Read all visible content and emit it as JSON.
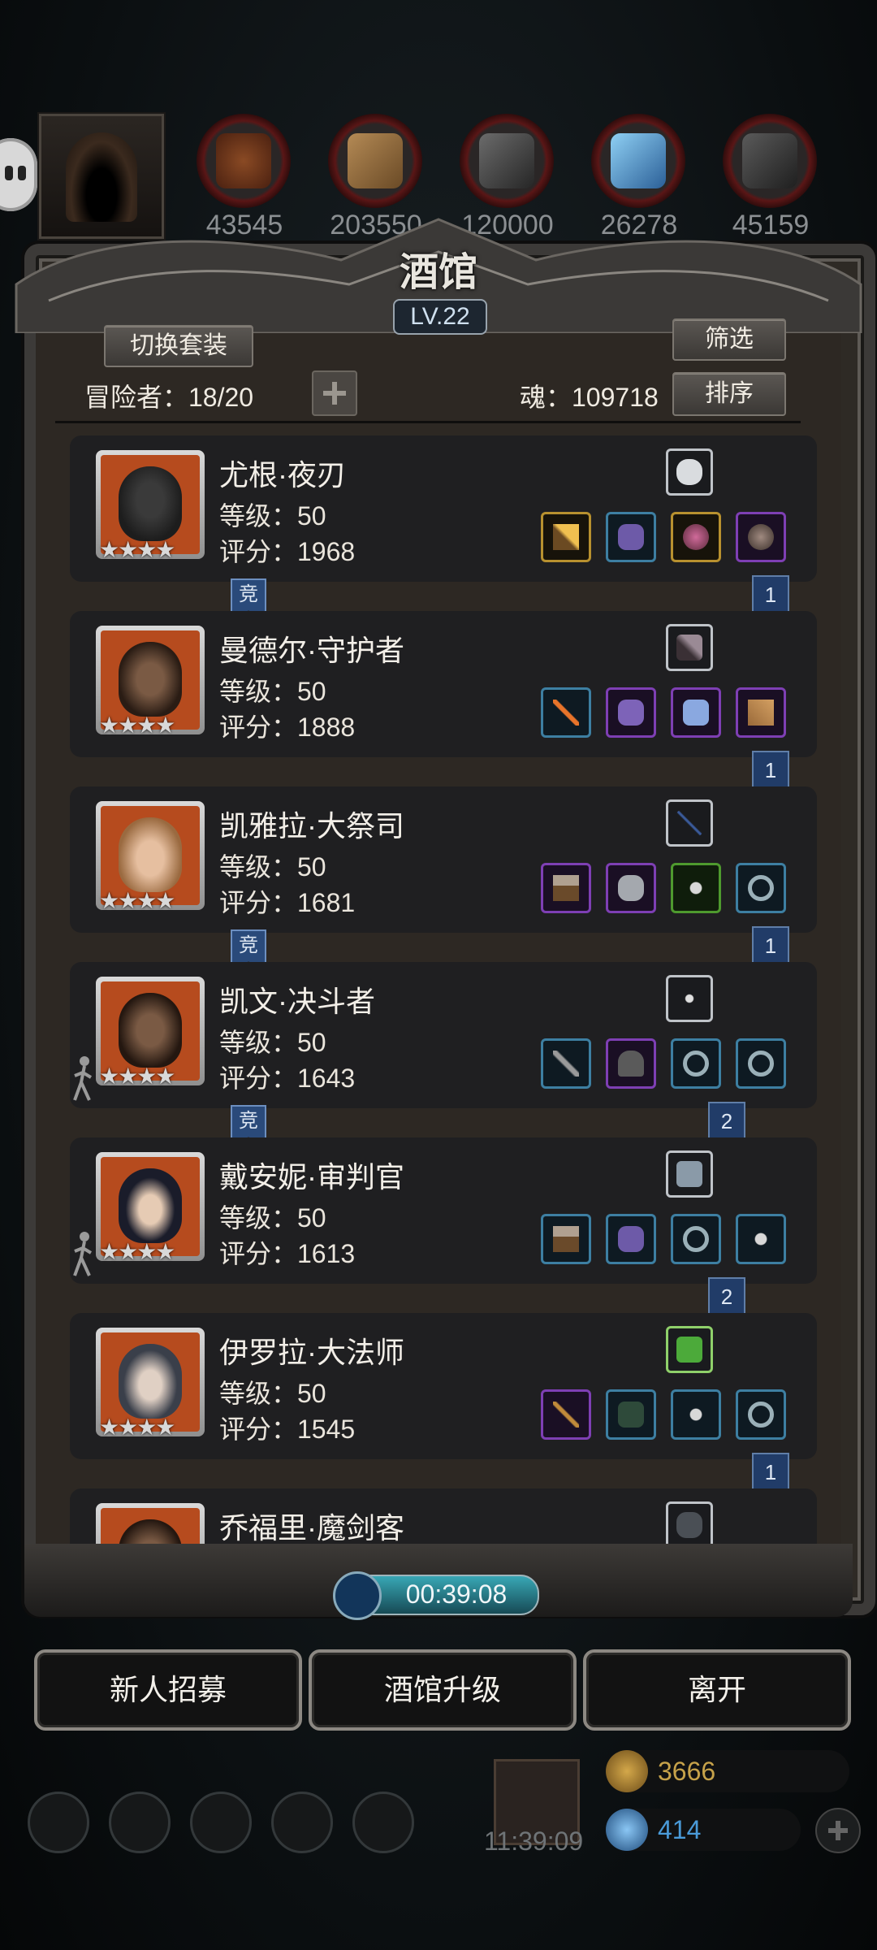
{
  "resources": [
    {
      "icon": "wood-log-icon",
      "value": "43545",
      "color": "#7a3a1a"
    },
    {
      "icon": "plank-icon",
      "value": "203550",
      "color": "#8a6a3a"
    },
    {
      "icon": "stone-block-icon",
      "value": "120000",
      "color": "#4a4a4a"
    },
    {
      "icon": "crystal-icon",
      "value": "26278",
      "color": "#3b7bb8"
    },
    {
      "icon": "iron-ingot-icon",
      "value": "45159",
      "color": "#3c3c3c"
    }
  ],
  "panel": {
    "title": "酒馆",
    "level": "LV.22",
    "switch_outfit_label": "切换套装",
    "filter_label": "筛选",
    "sort_label": "排序",
    "adventurers_text": "冒险者：18/20",
    "soul_text": "魂：109718"
  },
  "heroes": [
    {
      "name": "尤根·夜刃",
      "level": "等级：50",
      "score": "评分：1968",
      "stars": "★★★★",
      "badge": "竞",
      "ribbon": "1"
    },
    {
      "name": "曼德尔·守护者",
      "level": "等级：50",
      "score": "评分：1888",
      "stars": "★★★★",
      "badge": "",
      "ribbon": "1"
    },
    {
      "name": "凯雅拉·大祭司",
      "level": "等级：50",
      "score": "评分：1681",
      "stars": "★★★★",
      "badge": "竞",
      "ribbon": "1"
    },
    {
      "name": "凯文·决斗者",
      "level": "等级：50",
      "score": "评分：1643",
      "stars": "★★★★",
      "badge": "竞",
      "ribbon": "2"
    },
    {
      "name": "戴安妮·审判官",
      "level": "等级：50",
      "score": "评分：1613",
      "stars": "★★★★",
      "badge": "",
      "ribbon": "2"
    },
    {
      "name": "伊罗拉·大法师",
      "level": "等级：50",
      "score": "评分：1545",
      "stars": "★★★★",
      "badge": "",
      "ribbon": "1"
    },
    {
      "name": "乔福里·魔剑客",
      "level": "",
      "score": "",
      "stars": "",
      "badge": "",
      "ribbon": ""
    }
  ],
  "timer": "00:39:08",
  "actions": {
    "recruit": "新人招募",
    "upgrade": "酒馆升级",
    "leave": "离开"
  },
  "footer": {
    "clock": "11:39:09",
    "gold": "3666",
    "gems": "414"
  },
  "colors": {
    "gold_text": "#c6a24a",
    "gem_text": "#4a9ad8"
  }
}
